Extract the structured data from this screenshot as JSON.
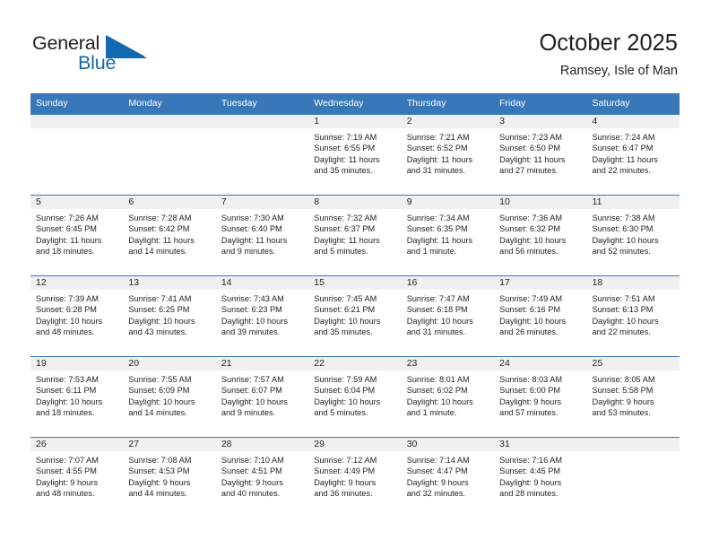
{
  "brand": {
    "name_part1": "General",
    "name_part2": "Blue",
    "triangle_color": "#1269b0"
  },
  "header": {
    "title": "October 2025",
    "subtitle": "Ramsey, Isle of Man"
  },
  "colors": {
    "header_band": "#3878b8",
    "daynum_band": "#f0f0f0",
    "text": "#231f20",
    "accent_blue": "#1269b0"
  },
  "calendar": {
    "weekday_headers": [
      "Sunday",
      "Monday",
      "Tuesday",
      "Wednesday",
      "Thursday",
      "Friday",
      "Saturday"
    ],
    "weeks": [
      [
        {
          "day": "",
          "empty": true,
          "sunrise": "",
          "sunset": "",
          "daylight_line1": "",
          "daylight_line2": ""
        },
        {
          "day": "",
          "empty": true,
          "sunrise": "",
          "sunset": "",
          "daylight_line1": "",
          "daylight_line2": ""
        },
        {
          "day": "",
          "empty": true,
          "sunrise": "",
          "sunset": "",
          "daylight_line1": "",
          "daylight_line2": ""
        },
        {
          "day": "1",
          "empty": false,
          "sunrise": "Sunrise: 7:19 AM",
          "sunset": "Sunset: 6:55 PM",
          "daylight_line1": "Daylight: 11 hours",
          "daylight_line2": "and 35 minutes."
        },
        {
          "day": "2",
          "empty": false,
          "sunrise": "Sunrise: 7:21 AM",
          "sunset": "Sunset: 6:52 PM",
          "daylight_line1": "Daylight: 11 hours",
          "daylight_line2": "and 31 minutes."
        },
        {
          "day": "3",
          "empty": false,
          "sunrise": "Sunrise: 7:23 AM",
          "sunset": "Sunset: 6:50 PM",
          "daylight_line1": "Daylight: 11 hours",
          "daylight_line2": "and 27 minutes."
        },
        {
          "day": "4",
          "empty": false,
          "sunrise": "Sunrise: 7:24 AM",
          "sunset": "Sunset: 6:47 PM",
          "daylight_line1": "Daylight: 11 hours",
          "daylight_line2": "and 22 minutes."
        }
      ],
      [
        {
          "day": "5",
          "empty": false,
          "sunrise": "Sunrise: 7:26 AM",
          "sunset": "Sunset: 6:45 PM",
          "daylight_line1": "Daylight: 11 hours",
          "daylight_line2": "and 18 minutes."
        },
        {
          "day": "6",
          "empty": false,
          "sunrise": "Sunrise: 7:28 AM",
          "sunset": "Sunset: 6:42 PM",
          "daylight_line1": "Daylight: 11 hours",
          "daylight_line2": "and 14 minutes."
        },
        {
          "day": "7",
          "empty": false,
          "sunrise": "Sunrise: 7:30 AM",
          "sunset": "Sunset: 6:40 PM",
          "daylight_line1": "Daylight: 11 hours",
          "daylight_line2": "and 9 minutes."
        },
        {
          "day": "8",
          "empty": false,
          "sunrise": "Sunrise: 7:32 AM",
          "sunset": "Sunset: 6:37 PM",
          "daylight_line1": "Daylight: 11 hours",
          "daylight_line2": "and 5 minutes."
        },
        {
          "day": "9",
          "empty": false,
          "sunrise": "Sunrise: 7:34 AM",
          "sunset": "Sunset: 6:35 PM",
          "daylight_line1": "Daylight: 11 hours",
          "daylight_line2": "and 1 minute."
        },
        {
          "day": "10",
          "empty": false,
          "sunrise": "Sunrise: 7:36 AM",
          "sunset": "Sunset: 6:32 PM",
          "daylight_line1": "Daylight: 10 hours",
          "daylight_line2": "and 56 minutes."
        },
        {
          "day": "11",
          "empty": false,
          "sunrise": "Sunrise: 7:38 AM",
          "sunset": "Sunset: 6:30 PM",
          "daylight_line1": "Daylight: 10 hours",
          "daylight_line2": "and 52 minutes."
        }
      ],
      [
        {
          "day": "12",
          "empty": false,
          "sunrise": "Sunrise: 7:39 AM",
          "sunset": "Sunset: 6:28 PM",
          "daylight_line1": "Daylight: 10 hours",
          "daylight_line2": "and 48 minutes."
        },
        {
          "day": "13",
          "empty": false,
          "sunrise": "Sunrise: 7:41 AM",
          "sunset": "Sunset: 6:25 PM",
          "daylight_line1": "Daylight: 10 hours",
          "daylight_line2": "and 43 minutes."
        },
        {
          "day": "14",
          "empty": false,
          "sunrise": "Sunrise: 7:43 AM",
          "sunset": "Sunset: 6:23 PM",
          "daylight_line1": "Daylight: 10 hours",
          "daylight_line2": "and 39 minutes."
        },
        {
          "day": "15",
          "empty": false,
          "sunrise": "Sunrise: 7:45 AM",
          "sunset": "Sunset: 6:21 PM",
          "daylight_line1": "Daylight: 10 hours",
          "daylight_line2": "and 35 minutes."
        },
        {
          "day": "16",
          "empty": false,
          "sunrise": "Sunrise: 7:47 AM",
          "sunset": "Sunset: 6:18 PM",
          "daylight_line1": "Daylight: 10 hours",
          "daylight_line2": "and 31 minutes."
        },
        {
          "day": "17",
          "empty": false,
          "sunrise": "Sunrise: 7:49 AM",
          "sunset": "Sunset: 6:16 PM",
          "daylight_line1": "Daylight: 10 hours",
          "daylight_line2": "and 26 minutes."
        },
        {
          "day": "18",
          "empty": false,
          "sunrise": "Sunrise: 7:51 AM",
          "sunset": "Sunset: 6:13 PM",
          "daylight_line1": "Daylight: 10 hours",
          "daylight_line2": "and 22 minutes."
        }
      ],
      [
        {
          "day": "19",
          "empty": false,
          "sunrise": "Sunrise: 7:53 AM",
          "sunset": "Sunset: 6:11 PM",
          "daylight_line1": "Daylight: 10 hours",
          "daylight_line2": "and 18 minutes."
        },
        {
          "day": "20",
          "empty": false,
          "sunrise": "Sunrise: 7:55 AM",
          "sunset": "Sunset: 6:09 PM",
          "daylight_line1": "Daylight: 10 hours",
          "daylight_line2": "and 14 minutes."
        },
        {
          "day": "21",
          "empty": false,
          "sunrise": "Sunrise: 7:57 AM",
          "sunset": "Sunset: 6:07 PM",
          "daylight_line1": "Daylight: 10 hours",
          "daylight_line2": "and 9 minutes."
        },
        {
          "day": "22",
          "empty": false,
          "sunrise": "Sunrise: 7:59 AM",
          "sunset": "Sunset: 6:04 PM",
          "daylight_line1": "Daylight: 10 hours",
          "daylight_line2": "and 5 minutes."
        },
        {
          "day": "23",
          "empty": false,
          "sunrise": "Sunrise: 8:01 AM",
          "sunset": "Sunset: 6:02 PM",
          "daylight_line1": "Daylight: 10 hours",
          "daylight_line2": "and 1 minute."
        },
        {
          "day": "24",
          "empty": false,
          "sunrise": "Sunrise: 8:03 AM",
          "sunset": "Sunset: 6:00 PM",
          "daylight_line1": "Daylight: 9 hours",
          "daylight_line2": "and 57 minutes."
        },
        {
          "day": "25",
          "empty": false,
          "sunrise": "Sunrise: 8:05 AM",
          "sunset": "Sunset: 5:58 PM",
          "daylight_line1": "Daylight: 9 hours",
          "daylight_line2": "and 53 minutes."
        }
      ],
      [
        {
          "day": "26",
          "empty": false,
          "sunrise": "Sunrise: 7:07 AM",
          "sunset": "Sunset: 4:55 PM",
          "daylight_line1": "Daylight: 9 hours",
          "daylight_line2": "and 48 minutes."
        },
        {
          "day": "27",
          "empty": false,
          "sunrise": "Sunrise: 7:08 AM",
          "sunset": "Sunset: 4:53 PM",
          "daylight_line1": "Daylight: 9 hours",
          "daylight_line2": "and 44 minutes."
        },
        {
          "day": "28",
          "empty": false,
          "sunrise": "Sunrise: 7:10 AM",
          "sunset": "Sunset: 4:51 PM",
          "daylight_line1": "Daylight: 9 hours",
          "daylight_line2": "and 40 minutes."
        },
        {
          "day": "29",
          "empty": false,
          "sunrise": "Sunrise: 7:12 AM",
          "sunset": "Sunset: 4:49 PM",
          "daylight_line1": "Daylight: 9 hours",
          "daylight_line2": "and 36 minutes."
        },
        {
          "day": "30",
          "empty": false,
          "sunrise": "Sunrise: 7:14 AM",
          "sunset": "Sunset: 4:47 PM",
          "daylight_line1": "Daylight: 9 hours",
          "daylight_line2": "and 32 minutes."
        },
        {
          "day": "31",
          "empty": false,
          "sunrise": "Sunrise: 7:16 AM",
          "sunset": "Sunset: 4:45 PM",
          "daylight_line1": "Daylight: 9 hours",
          "daylight_line2": "and 28 minutes."
        },
        {
          "day": "",
          "empty": true,
          "sunrise": "",
          "sunset": "",
          "daylight_line1": "",
          "daylight_line2": ""
        }
      ]
    ]
  }
}
